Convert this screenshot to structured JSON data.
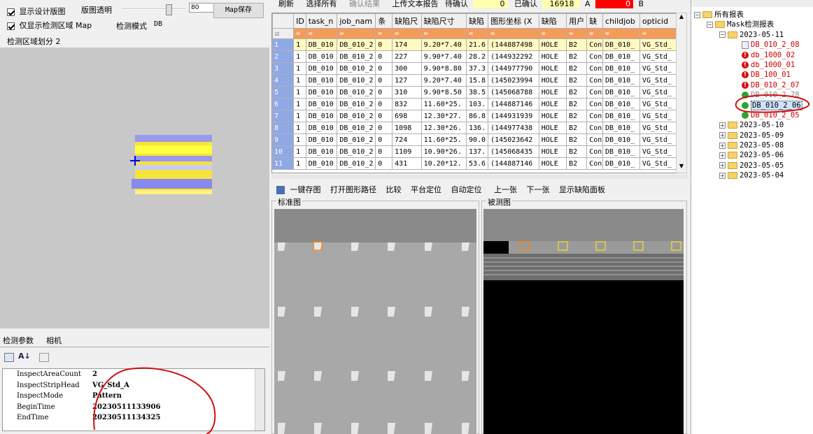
{
  "left": {
    "chk_design": "显示设计版图",
    "opacity_label": "版图透明",
    "opacity_value": "80",
    "map_save": "Map保存",
    "chk_inspect": "仅显示检测区域 Map",
    "mode_label": "检测模式",
    "mode_value": "DB",
    "region_label": "检测区域划分 2",
    "tabs": [
      "检测参数",
      "相机"
    ],
    "props": [
      {
        "k": "InspectAreaCount",
        "v": "2"
      },
      {
        "k": "InspectStripHead",
        "v": "VG_Std_A"
      },
      {
        "k": "InspectMode",
        "v": "Pattern"
      },
      {
        "k": "BeginTime",
        "v": "20230511133906"
      },
      {
        "k": "EndTime",
        "v": "20230511134325"
      }
    ]
  },
  "toolbar": {
    "refresh": "刷新",
    "select_all": "选择所有",
    "confirm": "确认结果",
    "upload": "上传文本报告",
    "pending_label": "待确认",
    "pending_value": "0",
    "confirmed_label": "已确认",
    "confirmed_value": "16918",
    "a_label": "A",
    "a_value": "0",
    "b_label": "B"
  },
  "grid": {
    "headers": [
      "ID",
      "task_n",
      "job_nam",
      "条",
      "缺陷尺",
      "缺陷尺寸",
      "缺陷",
      "图形坐标 (X",
      "缺陷",
      "用户",
      "缺",
      "childjob",
      "opticid"
    ],
    "filter": "=",
    "rows": [
      [
        "1",
        "1",
        "DB_010",
        "DB_010_2",
        "0",
        "174",
        "9.20*7.40",
        "21.6",
        "(144887498",
        "HOLE",
        "B2",
        "Con",
        "DB_010_",
        "VG_Std_"
      ],
      [
        "2",
        "1",
        "DB_010",
        "DB_010_2",
        "0",
        "227",
        "9.90*7.40",
        "28.2",
        "(144932292",
        "HOLE",
        "B2",
        "Con",
        "DB_010_",
        "VG_Std_"
      ],
      [
        "3",
        "1",
        "DB_010",
        "DB_010_2",
        "0",
        "300",
        "9.90*8.80",
        "37.3",
        "(144977790",
        "HOLE",
        "B2",
        "Con",
        "DB_010_",
        "VG_Std_"
      ],
      [
        "4",
        "1",
        "DB_010",
        "DB_010_2",
        "0",
        "127",
        "9.20*7.40",
        "15.8",
        "(145023994",
        "HOLE",
        "B2",
        "Con",
        "DB_010_",
        "VG_Std_"
      ],
      [
        "5",
        "1",
        "DB_010",
        "DB_010_2",
        "0",
        "310",
        "9.90*8.50",
        "38.5",
        "(145068788",
        "HOLE",
        "B2",
        "Con",
        "DB_010_",
        "VG_Std_"
      ],
      [
        "6",
        "1",
        "DB_010",
        "DB_010_2",
        "0",
        "832",
        "11.60*25.",
        "103.",
        "(144887146",
        "HOLE",
        "B2",
        "Con",
        "DB_010_",
        "VG_Std_"
      ],
      [
        "7",
        "1",
        "DB_010",
        "DB_010_2",
        "0",
        "698",
        "12.30*27.",
        "86.8",
        "(144931939",
        "HOLE",
        "B2",
        "Con",
        "DB_010_",
        "VG_Std_"
      ],
      [
        "8",
        "1",
        "DB_010",
        "DB_010_2",
        "0",
        "1098",
        "12.30*26.",
        "136.",
        "(144977438",
        "HOLE",
        "B2",
        "Con",
        "DB_010_",
        "VG_Std_"
      ],
      [
        "9",
        "1",
        "DB_010",
        "DB_010_2",
        "0",
        "724",
        "11.60*25.",
        "90.0",
        "(145023642",
        "HOLE",
        "B2",
        "Con",
        "DB_010_",
        "VG_Std_"
      ],
      [
        "10",
        "1",
        "DB_010",
        "DB_010_2",
        "0",
        "1109",
        "10.90*26.",
        "137.",
        "(145068435",
        "HOLE",
        "B2",
        "Con",
        "DB_010_",
        "VG_Std_"
      ],
      [
        "11",
        "1",
        "DB_010",
        "DB_010_2",
        "0",
        "431",
        "10.20*12.",
        "53.6",
        "(144887146",
        "HOLE",
        "B2",
        "Con",
        "DB_010_",
        "VG_Std_"
      ]
    ]
  },
  "viewer": {
    "save": "一键存图",
    "open_path": "打开图形路径",
    "compare": "比较",
    "platform": "平台定位",
    "auto": "自动定位",
    "prev": "上一张",
    "next": "下一张",
    "show_panel": "显示缺陷面板",
    "std_label": "标准图",
    "test_label": "被测图"
  },
  "tree": {
    "root": "所有报表",
    "mask": "Mask检测报表",
    "date_open": "2023-05-11",
    "items": [
      "DB_010_2_08",
      "db_1000_02",
      "db_1000_01",
      "DB_100_01",
      "DB_010_2_07",
      "DB_010_2_78",
      "DB_010_2_06",
      "DB_010_2_05"
    ],
    "dates": [
      "2023-05-10",
      "2023-05-09",
      "2023-05-08",
      "2023-05-06",
      "2023-05-05",
      "2023-05-04"
    ]
  }
}
